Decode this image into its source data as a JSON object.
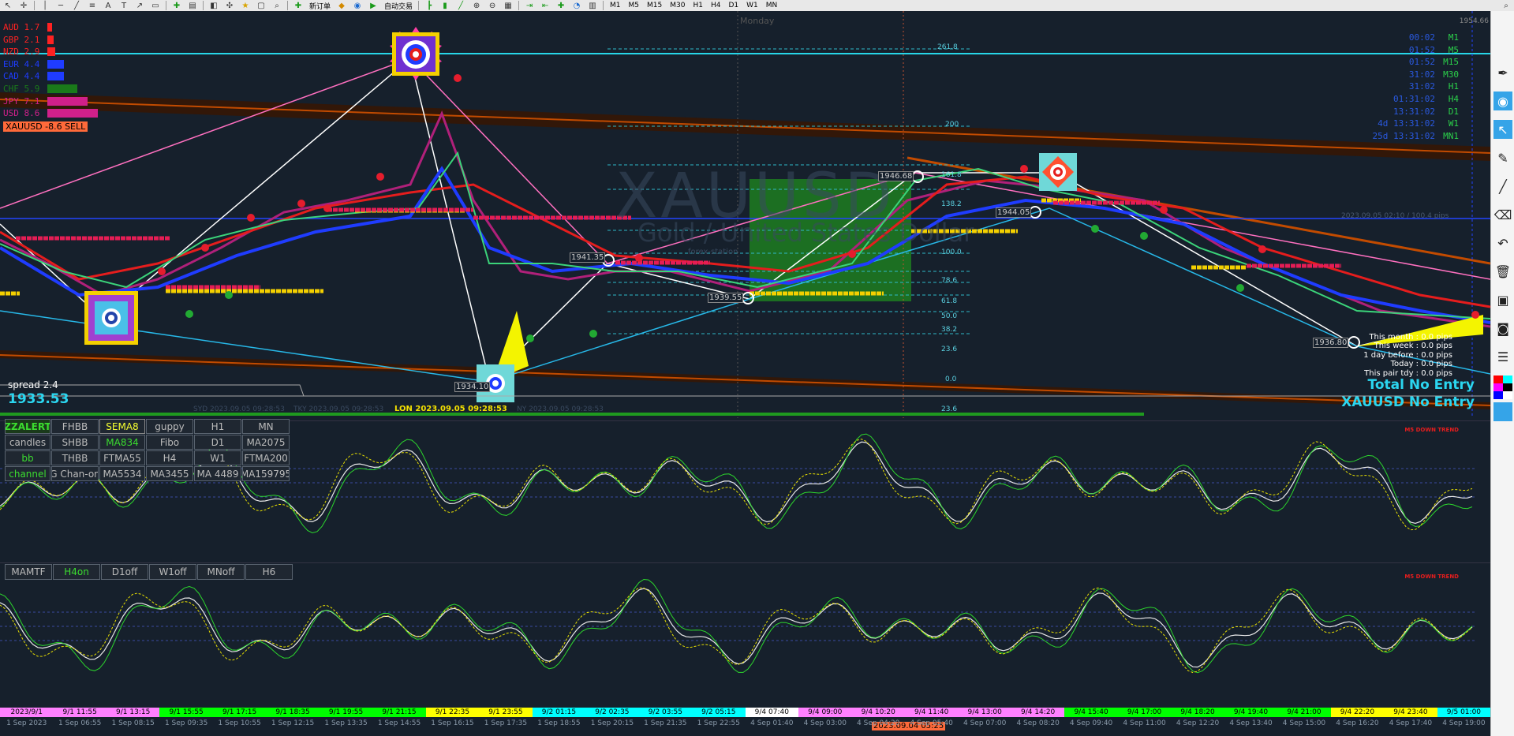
{
  "toolbar": {
    "items": [
      "cursor-icon",
      "crosshair-icon",
      "vline-icon",
      "hline-icon",
      "trendline-icon",
      "channel-icon",
      "text-icon",
      "label-icon",
      "arrow-icon",
      "shapes-icon",
      "add-icon",
      "chart-icon",
      "profiles-icon",
      "history-icon",
      "gear-icon",
      "star-icon",
      "folder-icon",
      "search-icon"
    ],
    "new_order": "新订单",
    "auto_trading": "自动交易",
    "timeframes": [
      "M1",
      "M5",
      "M15",
      "M30",
      "H1",
      "H4",
      "D1",
      "W1",
      "MN"
    ]
  },
  "chart": {
    "symbol_watermark": "XAUUSD",
    "symbol_subtitle": "Gold / United States Dollar",
    "watermark_small": "forex-station",
    "day_label": "Monday",
    "spread_label": "spread 2.4",
    "current_price": "1933.53",
    "lon_label": "LON 2023.09.05 09:28:53",
    "total_no_entry": "Total No Entry",
    "pair_no_entry": "XAUUSD No Entry",
    "top_right_price": "1954.66",
    "channel_label": "2023.09.05 02:10 / 100.4 pips",
    "down_trend_1": "M5 DOWN TREND",
    "down_trend_2": "M5 DOWN TREND",
    "price_tags": [
      "1941.35",
      "1939.55",
      "1944.05",
      "1946.68",
      "1934.10",
      "1936.80"
    ],
    "fib_levels": [
      "261.8",
      "200",
      "161.8",
      "138.2",
      "100.0",
      "78.6",
      "61.8",
      "50.0",
      "38.2",
      "23.6",
      "0.0",
      "23.6"
    ],
    "session_labels": [
      "SYD 2023.09.05 09:28:53",
      "TKY 2023.09.05 09:28:53",
      "NY 2023.09.05 09:28:53"
    ]
  },
  "currencies": [
    {
      "name": "AUD",
      "value": "1.7",
      "color": "#ff2222",
      "bar": 0.1
    },
    {
      "name": "GBP",
      "value": "2.1",
      "color": "#ff2222",
      "bar": 0.12
    },
    {
      "name": "NZD",
      "value": "2.9",
      "color": "#ff2222",
      "bar": 0.15
    },
    {
      "name": "EUR",
      "value": "4.4",
      "color": "#1f3cff",
      "bar": 0.33
    },
    {
      "name": "CAD",
      "value": "4.4",
      "color": "#1f3cff",
      "bar": 0.33
    },
    {
      "name": "CHF",
      "value": "5.9",
      "color": "#1a7a1a",
      "bar": 0.6
    },
    {
      "name": "JPY",
      "value": "7.1",
      "color": "#d0208a",
      "bar": 0.8
    },
    {
      "name": "USD",
      "value": "8.6",
      "color": "#d0208a",
      "bar": 1.0
    }
  ],
  "signal": "XAUUSD -8.6 SELL",
  "timeframe_clock": [
    {
      "time": "00:02",
      "tf": "M1"
    },
    {
      "time": "01:52",
      "tf": "M5"
    },
    {
      "time": "01:52",
      "tf": "M15"
    },
    {
      "time": "31:02",
      "tf": "M30"
    },
    {
      "time": "31:02",
      "tf": "H1"
    },
    {
      "time": "01:31:02",
      "tf": "H4"
    },
    {
      "time": "13:31:02",
      "tf": "D1"
    },
    {
      "time": "4d 13:31:02",
      "tf": "W1"
    },
    {
      "time": "25d 13:31:02",
      "tf": "MN1"
    }
  ],
  "pips_info": [
    "This month : 0.0 pips",
    "This week : 0.0 pips",
    "1 day before : 0.0 pips",
    "Today : 0.0 pips",
    "This pair tdy : 0.0 pips"
  ],
  "button_grid": [
    [
      "ZZALERT",
      "FHBB",
      "SEMA8",
      "guppy",
      "H1",
      "MN"
    ],
    [
      "candles",
      "SHBB",
      "MA834",
      "Fibo",
      "D1",
      "MA2075"
    ],
    [
      "bb",
      "THBB",
      "FTMA55",
      "H4",
      "W1",
      "FTMA200"
    ],
    [
      "channel",
      "G Chan-on",
      "MA5534",
      "MA3455",
      "MA 4489",
      "MA159795"
    ]
  ],
  "mtf_buttons": [
    "MAMTF",
    "H4on",
    "D1off",
    "W1off",
    "MNoff",
    "H6"
  ],
  "ticker_times": [
    "2023/9/1",
    "9/1 11:55",
    "9/1 13:15",
    "9/1 15:55",
    "9/1 17:15",
    "9/1 18:35",
    "9/1 19:55",
    "9/1 21:15",
    "9/1 22:35",
    "9/1 23:55",
    "9/2 01:15",
    "9/2 02:35",
    "9/2 03:55",
    "9/2 05:15",
    "9/4 07:40",
    "9/4 09:00",
    "9/4 10:20",
    "9/4 11:40",
    "9/4 13:00",
    "9/4 14:20",
    "9/4 15:40",
    "9/4 17:00",
    "9/4 18:20",
    "9/4 19:40",
    "9/4 21:00",
    "9/4 22:20",
    "9/4 23:40",
    "9/5 01:00"
  ],
  "ticker_colors": [
    "#ff80ff",
    "#ff80ff",
    "#ff80ff",
    "#00ff00",
    "#00ff00",
    "#00ff00",
    "#00ff00",
    "#00ff00",
    "#ffff00",
    "#ffff00",
    "#00ffff",
    "#00ffff",
    "#00ffff",
    "#00ffff",
    "#ffffff",
    "#ff80ff",
    "#ff80ff",
    "#ff80ff",
    "#ff80ff",
    "#ff80ff",
    "#00ff00",
    "#00ff00",
    "#00ff00",
    "#00ff00",
    "#00ff00",
    "#ffff00",
    "#ffff00",
    "#00ffff"
  ],
  "date_labels": [
    "1 Sep 2023",
    "1 Sep 06:55",
    "1 Sep 08:15",
    "1 Sep 09:35",
    "1 Sep 10:55",
    "1 Sep 12:15",
    "1 Sep 13:35",
    "1 Sep 14:55",
    "1 Sep 16:15",
    "1 Sep 17:35",
    "1 Sep 18:55",
    "1 Sep 20:15",
    "1 Sep 21:35",
    "1 Sep 22:55",
    "4 Sep 01:40",
    "4 Sep 03:00",
    "4 Sep 04:20",
    "4 Sep 05:40",
    "4 Sep 07:00",
    "4 Sep 08:20",
    "4 Sep 09:40",
    "4 Sep 11:00",
    "4 Sep 12:20",
    "4 Sep 13:40",
    "4 Sep 15:00",
    "4 Sep 16:20",
    "4 Sep 17:40",
    "4 Sep 19:00"
  ],
  "cursor_time": "2023.09.04 05:25"
}
